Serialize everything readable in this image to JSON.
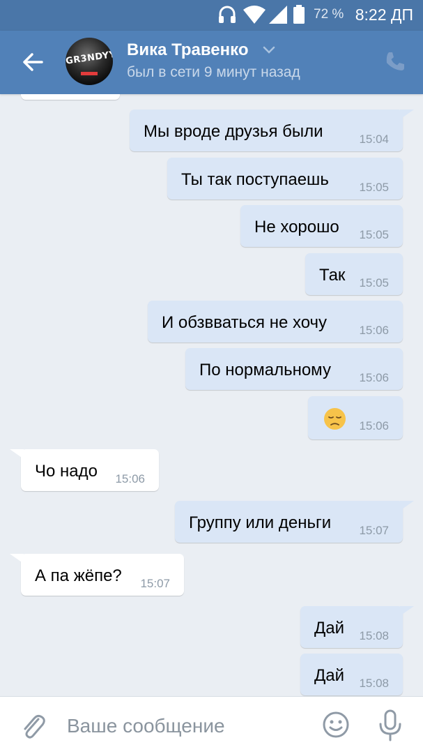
{
  "status_bar": {
    "battery_percent": "72 %",
    "time": "8:22 ДП",
    "icons": [
      "headset-icon",
      "wifi-icon",
      "signal-icon",
      "battery-icon"
    ]
  },
  "header": {
    "contact_name": "Вика Травенко",
    "contact_status": "был в сети 9 минут назад",
    "avatar_text": "GR3NDYY",
    "colors": {
      "header_bg": "#5181b8",
      "status_bar_bg": "#4a76a8"
    }
  },
  "messages": [
    {
      "direction": "out",
      "text": "Мы вроде друзья были",
      "time": "15:04"
    },
    {
      "direction": "out",
      "text": "Ты так поступаешь",
      "time": "15:05"
    },
    {
      "direction": "out",
      "text": "Не хорошо",
      "time": "15:05"
    },
    {
      "direction": "out",
      "text": "Так",
      "time": "15:05"
    },
    {
      "direction": "out",
      "text": "И обзвваться не хочу",
      "time": "15:06"
    },
    {
      "direction": "out",
      "text": "По нормальному",
      "time": "15:06"
    },
    {
      "direction": "out",
      "text": "",
      "emoji": "pensive-face-icon",
      "time": "15:06"
    },
    {
      "direction": "in",
      "text": "Чо надо",
      "time": "15:06"
    },
    {
      "direction": "out",
      "text": "Группу или деньги",
      "time": "15:07"
    },
    {
      "direction": "in",
      "text": "А па жёпе?",
      "time": "15:07"
    },
    {
      "direction": "out",
      "text": "Дай",
      "time": "15:08"
    },
    {
      "direction": "out",
      "text": "Дай",
      "time": "15:08"
    }
  ],
  "composer": {
    "placeholder": "Ваше сообщение",
    "value": ""
  },
  "colors": {
    "chat_bg": "#eaeef3",
    "outgoing_bubble": "#dae6f6",
    "incoming_bubble": "#ffffff",
    "timestamp": "#8d9aa7"
  }
}
